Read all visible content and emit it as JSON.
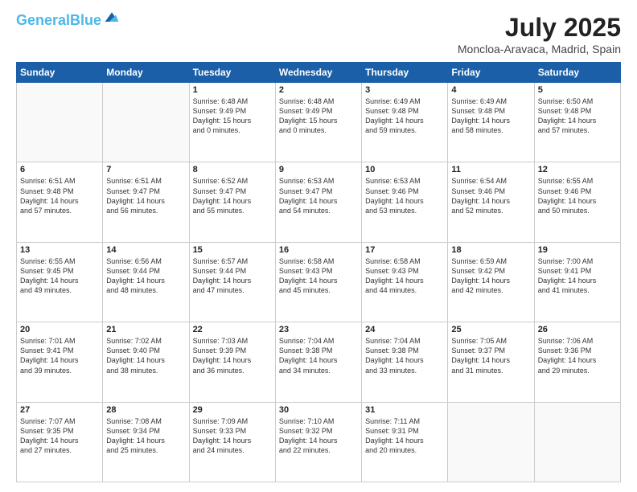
{
  "header": {
    "logo_line1": "General",
    "logo_line2": "Blue",
    "month": "July 2025",
    "location": "Moncloa-Aravaca, Madrid, Spain"
  },
  "weekdays": [
    "Sunday",
    "Monday",
    "Tuesday",
    "Wednesday",
    "Thursday",
    "Friday",
    "Saturday"
  ],
  "weeks": [
    [
      {
        "day": "",
        "info": ""
      },
      {
        "day": "",
        "info": ""
      },
      {
        "day": "1",
        "info": "Sunrise: 6:48 AM\nSunset: 9:49 PM\nDaylight: 15 hours\nand 0 minutes."
      },
      {
        "day": "2",
        "info": "Sunrise: 6:48 AM\nSunset: 9:49 PM\nDaylight: 15 hours\nand 0 minutes."
      },
      {
        "day": "3",
        "info": "Sunrise: 6:49 AM\nSunset: 9:48 PM\nDaylight: 14 hours\nand 59 minutes."
      },
      {
        "day": "4",
        "info": "Sunrise: 6:49 AM\nSunset: 9:48 PM\nDaylight: 14 hours\nand 58 minutes."
      },
      {
        "day": "5",
        "info": "Sunrise: 6:50 AM\nSunset: 9:48 PM\nDaylight: 14 hours\nand 57 minutes."
      }
    ],
    [
      {
        "day": "6",
        "info": "Sunrise: 6:51 AM\nSunset: 9:48 PM\nDaylight: 14 hours\nand 57 minutes."
      },
      {
        "day": "7",
        "info": "Sunrise: 6:51 AM\nSunset: 9:47 PM\nDaylight: 14 hours\nand 56 minutes."
      },
      {
        "day": "8",
        "info": "Sunrise: 6:52 AM\nSunset: 9:47 PM\nDaylight: 14 hours\nand 55 minutes."
      },
      {
        "day": "9",
        "info": "Sunrise: 6:53 AM\nSunset: 9:47 PM\nDaylight: 14 hours\nand 54 minutes."
      },
      {
        "day": "10",
        "info": "Sunrise: 6:53 AM\nSunset: 9:46 PM\nDaylight: 14 hours\nand 53 minutes."
      },
      {
        "day": "11",
        "info": "Sunrise: 6:54 AM\nSunset: 9:46 PM\nDaylight: 14 hours\nand 52 minutes."
      },
      {
        "day": "12",
        "info": "Sunrise: 6:55 AM\nSunset: 9:46 PM\nDaylight: 14 hours\nand 50 minutes."
      }
    ],
    [
      {
        "day": "13",
        "info": "Sunrise: 6:55 AM\nSunset: 9:45 PM\nDaylight: 14 hours\nand 49 minutes."
      },
      {
        "day": "14",
        "info": "Sunrise: 6:56 AM\nSunset: 9:44 PM\nDaylight: 14 hours\nand 48 minutes."
      },
      {
        "day": "15",
        "info": "Sunrise: 6:57 AM\nSunset: 9:44 PM\nDaylight: 14 hours\nand 47 minutes."
      },
      {
        "day": "16",
        "info": "Sunrise: 6:58 AM\nSunset: 9:43 PM\nDaylight: 14 hours\nand 45 minutes."
      },
      {
        "day": "17",
        "info": "Sunrise: 6:58 AM\nSunset: 9:43 PM\nDaylight: 14 hours\nand 44 minutes."
      },
      {
        "day": "18",
        "info": "Sunrise: 6:59 AM\nSunset: 9:42 PM\nDaylight: 14 hours\nand 42 minutes."
      },
      {
        "day": "19",
        "info": "Sunrise: 7:00 AM\nSunset: 9:41 PM\nDaylight: 14 hours\nand 41 minutes."
      }
    ],
    [
      {
        "day": "20",
        "info": "Sunrise: 7:01 AM\nSunset: 9:41 PM\nDaylight: 14 hours\nand 39 minutes."
      },
      {
        "day": "21",
        "info": "Sunrise: 7:02 AM\nSunset: 9:40 PM\nDaylight: 14 hours\nand 38 minutes."
      },
      {
        "day": "22",
        "info": "Sunrise: 7:03 AM\nSunset: 9:39 PM\nDaylight: 14 hours\nand 36 minutes."
      },
      {
        "day": "23",
        "info": "Sunrise: 7:04 AM\nSunset: 9:38 PM\nDaylight: 14 hours\nand 34 minutes."
      },
      {
        "day": "24",
        "info": "Sunrise: 7:04 AM\nSunset: 9:38 PM\nDaylight: 14 hours\nand 33 minutes."
      },
      {
        "day": "25",
        "info": "Sunrise: 7:05 AM\nSunset: 9:37 PM\nDaylight: 14 hours\nand 31 minutes."
      },
      {
        "day": "26",
        "info": "Sunrise: 7:06 AM\nSunset: 9:36 PM\nDaylight: 14 hours\nand 29 minutes."
      }
    ],
    [
      {
        "day": "27",
        "info": "Sunrise: 7:07 AM\nSunset: 9:35 PM\nDaylight: 14 hours\nand 27 minutes."
      },
      {
        "day": "28",
        "info": "Sunrise: 7:08 AM\nSunset: 9:34 PM\nDaylight: 14 hours\nand 25 minutes."
      },
      {
        "day": "29",
        "info": "Sunrise: 7:09 AM\nSunset: 9:33 PM\nDaylight: 14 hours\nand 24 minutes."
      },
      {
        "day": "30",
        "info": "Sunrise: 7:10 AM\nSunset: 9:32 PM\nDaylight: 14 hours\nand 22 minutes."
      },
      {
        "day": "31",
        "info": "Sunrise: 7:11 AM\nSunset: 9:31 PM\nDaylight: 14 hours\nand 20 minutes."
      },
      {
        "day": "",
        "info": ""
      },
      {
        "day": "",
        "info": ""
      }
    ]
  ]
}
